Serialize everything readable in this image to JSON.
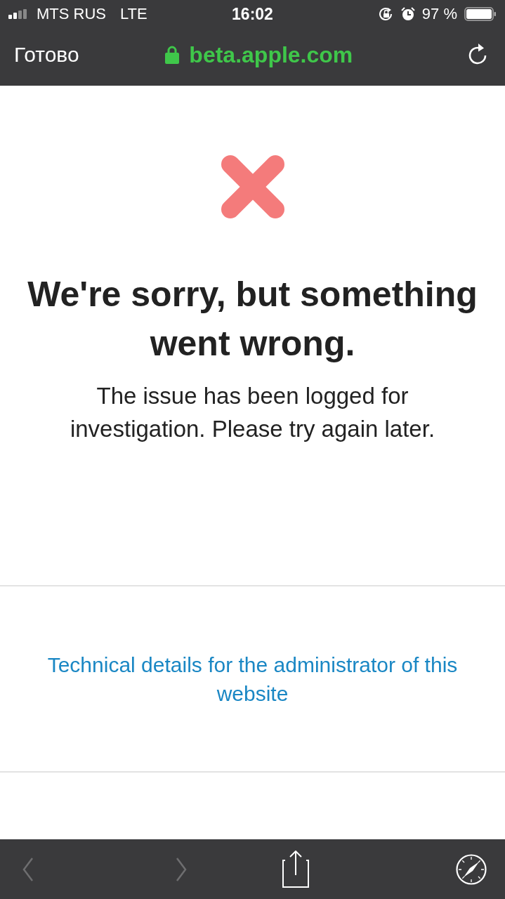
{
  "status_bar": {
    "carrier": "MTS RUS",
    "network": "LTE",
    "time": "16:02",
    "battery": "97 %"
  },
  "nav_bar": {
    "done": "Готово",
    "url": "beta.apple.com",
    "secure": true
  },
  "page": {
    "heading": "We're sorry, but something went wrong.",
    "message": "The issue has been logged for investigation. Please try again later.",
    "details_link": "Technical details for the administrator of this website"
  },
  "toolbar": [
    {
      "kind": "back",
      "disabled": true
    },
    {
      "kind": "forward",
      "disabled": true
    },
    {
      "kind": "share",
      "disabled": false
    },
    {
      "kind": "browser",
      "disabled": false
    }
  ]
}
